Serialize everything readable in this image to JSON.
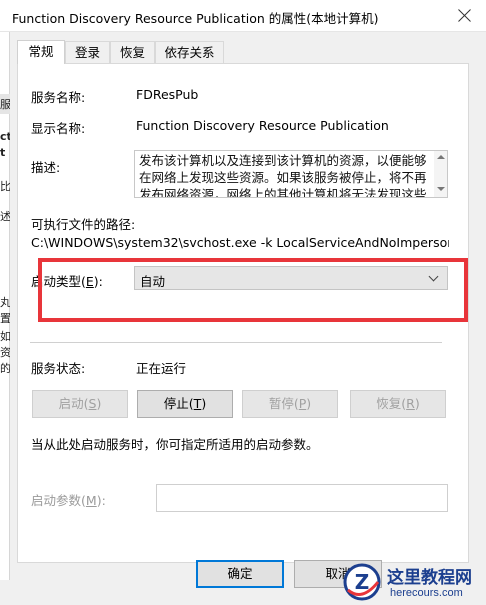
{
  "window": {
    "title": "Function Discovery Resource Publication 的属性(本地计算机)"
  },
  "background_window": {
    "fragments": [
      "服",
      "ct",
      "t",
      "比",
      "述",
      "丸",
      "置",
      "如",
      "资",
      "的",
      "序"
    ]
  },
  "tabs": [
    {
      "label": "常规",
      "active": true
    },
    {
      "label": "登录",
      "active": false
    },
    {
      "label": "恢复",
      "active": false
    },
    {
      "label": "依存关系",
      "active": false
    }
  ],
  "general": {
    "service_name_label": "服务名称:",
    "service_name_value": "FDResPub",
    "display_name_label": "显示名称:",
    "display_name_value": "Function Discovery Resource Publication",
    "description_label": "描述:",
    "description_value": "发布该计算机以及连接到该计算机的资源，以便能够在网络上发现这些资源。如果该服务被停止，将不再发布网络资源，网络上的其他计算机将无法发现这些资源。",
    "exe_path_label": "可执行文件的路径:",
    "exe_path_value": "C:\\WINDOWS\\system32\\svchost.exe -k LocalServiceAndNoImpersonation",
    "startup_type_label_prefix": "启动类型(",
    "startup_type_label_key": "E",
    "startup_type_label_suffix": "):",
    "startup_type_value": "自动",
    "highlight_color": "#e8353a",
    "service_status_label": "服务状态:",
    "service_status_value": "正在运行",
    "buttons": {
      "start": {
        "prefix": "启动(",
        "key": "S",
        "suffix": ")",
        "enabled": false
      },
      "stop": {
        "prefix": "停止(",
        "key": "T",
        "suffix": ")",
        "enabled": true
      },
      "pause": {
        "prefix": "暂停(",
        "key": "P",
        "suffix": ")",
        "enabled": false
      },
      "resume": {
        "prefix": "恢复(",
        "key": "R",
        "suffix": ")",
        "enabled": false
      }
    },
    "hint_text": "当从此处启动服务时，你可指定所适用的启动参数。",
    "start_params_label_prefix": "启动参数(",
    "start_params_label_key": "M",
    "start_params_label_suffix": "):",
    "start_params_value": ""
  },
  "dialog_buttons": {
    "ok": "确定",
    "cancel": "取消"
  },
  "watermark": {
    "logo_letter": "Z",
    "title": "这里教程网",
    "url": "herecours.com",
    "color": "#1c3f8f"
  }
}
